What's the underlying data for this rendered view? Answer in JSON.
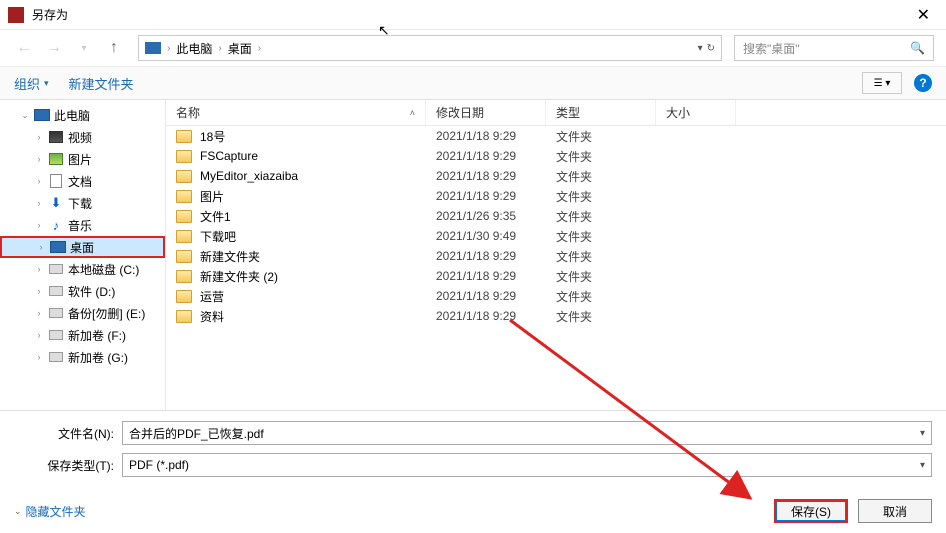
{
  "titlebar": {
    "title": "另存为"
  },
  "nav": {
    "breadcrumb": [
      "此电脑",
      "桌面"
    ],
    "search_placeholder": "搜索\"桌面\"",
    "refresh_label": "↻"
  },
  "toolbar": {
    "organize": "组织",
    "new_folder": "新建文件夹"
  },
  "sidebar": {
    "root": "此电脑",
    "items": [
      {
        "label": "视频",
        "icon": "video"
      },
      {
        "label": "图片",
        "icon": "picture"
      },
      {
        "label": "文档",
        "icon": "doc"
      },
      {
        "label": "下载",
        "icon": "download"
      },
      {
        "label": "音乐",
        "icon": "music"
      },
      {
        "label": "桌面",
        "icon": "monitor",
        "selected": true
      },
      {
        "label": "本地磁盘 (C:)",
        "icon": "disk"
      },
      {
        "label": "软件 (D:)",
        "icon": "disk"
      },
      {
        "label": "备份[勿删] (E:)",
        "icon": "disk"
      },
      {
        "label": "新加卷 (F:)",
        "icon": "disk"
      },
      {
        "label": "新加卷 (G:)",
        "icon": "disk"
      }
    ]
  },
  "columns": {
    "name": "名称",
    "date": "修改日期",
    "type": "类型",
    "size": "大小"
  },
  "files": [
    {
      "name": "18号",
      "date": "2021/1/18 9:29",
      "type": "文件夹"
    },
    {
      "name": "FSCapture",
      "date": "2021/1/18 9:29",
      "type": "文件夹"
    },
    {
      "name": "MyEditor_xiazaiba",
      "date": "2021/1/18 9:29",
      "type": "文件夹"
    },
    {
      "name": "图片",
      "date": "2021/1/18 9:29",
      "type": "文件夹"
    },
    {
      "name": "文件1",
      "date": "2021/1/26 9:35",
      "type": "文件夹"
    },
    {
      "name": "下载吧",
      "date": "2021/1/30 9:49",
      "type": "文件夹"
    },
    {
      "name": "新建文件夹",
      "date": "2021/1/18 9:29",
      "type": "文件夹"
    },
    {
      "name": "新建文件夹 (2)",
      "date": "2021/1/18 9:29",
      "type": "文件夹"
    },
    {
      "name": "运营",
      "date": "2021/1/18 9:29",
      "type": "文件夹"
    },
    {
      "name": "资料",
      "date": "2021/1/18 9:29",
      "type": "文件夹"
    }
  ],
  "form": {
    "filename_label": "文件名(N):",
    "filename_value": "合并后的PDF_已恢复.pdf",
    "filetype_label": "保存类型(T):",
    "filetype_value": "PDF (*.pdf)"
  },
  "footer": {
    "hide_folders": "隐藏文件夹",
    "save": "保存(S)",
    "cancel": "取消"
  }
}
